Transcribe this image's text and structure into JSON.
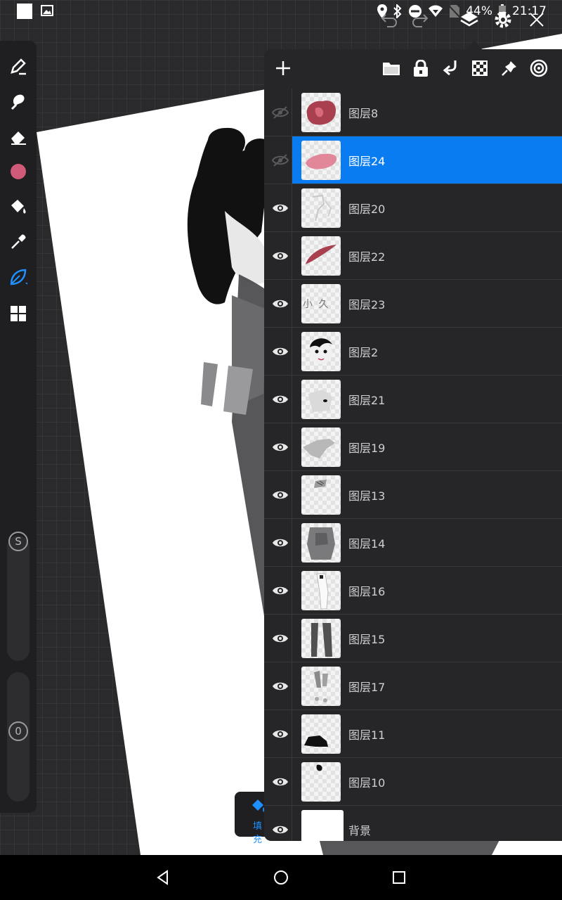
{
  "status_bar": {
    "battery": "44%",
    "time": "21:17",
    "icons": [
      "location-icon",
      "bluetooth-icon",
      "dnd-icon",
      "wifi-icon",
      "no-sim-icon",
      "battery-icon"
    ]
  },
  "toolbar": {
    "icons": [
      "undo-icon",
      "redo-icon",
      "layers-icon",
      "settings-icon",
      "close-icon"
    ]
  },
  "tools": {
    "items": [
      "pen-icon",
      "smudge-icon",
      "eraser-icon",
      "color-swatch",
      "fill-bucket-icon",
      "eyedropper-icon",
      "leaf-brush-icon",
      "grid-icon"
    ],
    "active": "leaf-brush-icon",
    "color": "#d05a78",
    "size_slider_label": "S",
    "opacity_slider_label": "0",
    "fill_label": "填充"
  },
  "layer_panel": {
    "header_icons": [
      "add-layer-icon",
      "folder-icon",
      "lock-icon",
      "merge-down-icon",
      "alpha-lock-icon",
      "pin-icon",
      "target-icon"
    ],
    "layers": [
      {
        "name": "图层8",
        "visible": false,
        "selected": false,
        "thumb": "blob-red"
      },
      {
        "name": "图层24",
        "visible": false,
        "selected": true,
        "thumb": "blob-pink"
      },
      {
        "name": "图层20",
        "visible": true,
        "selected": false,
        "thumb": "sketch-light"
      },
      {
        "name": "图层22",
        "visible": true,
        "selected": false,
        "thumb": "stroke-red"
      },
      {
        "name": "图层23",
        "visible": true,
        "selected": false,
        "thumb": "text-glyphs",
        "thumb_text": "小 久"
      },
      {
        "name": "图层2",
        "visible": true,
        "selected": false,
        "thumb": "face"
      },
      {
        "name": "图层21",
        "visible": true,
        "selected": false,
        "thumb": "body-light"
      },
      {
        "name": "图层19",
        "visible": true,
        "selected": false,
        "thumb": "arm-grey"
      },
      {
        "name": "图层13",
        "visible": true,
        "selected": false,
        "thumb": "small-pattern"
      },
      {
        "name": "图层14",
        "visible": true,
        "selected": false,
        "thumb": "torso-grey"
      },
      {
        "name": "图层16",
        "visible": true,
        "selected": false,
        "thumb": "legs-white"
      },
      {
        "name": "图层15",
        "visible": true,
        "selected": false,
        "thumb": "legs-grey"
      },
      {
        "name": "图层17",
        "visible": true,
        "selected": false,
        "thumb": "legs-detail"
      },
      {
        "name": "图层11",
        "visible": true,
        "selected": false,
        "thumb": "shoe-black"
      },
      {
        "name": "图层10",
        "visible": true,
        "selected": false,
        "thumb": "dot-black"
      },
      {
        "name": "背景",
        "visible": true,
        "selected": false,
        "thumb": "white"
      }
    ]
  },
  "nav_bar": {
    "icons": [
      "back-icon",
      "home-icon",
      "recents-icon"
    ]
  },
  "colors": {
    "accent": "#0a7cf2",
    "panel": "#262628",
    "rail": "#1f1f21"
  }
}
